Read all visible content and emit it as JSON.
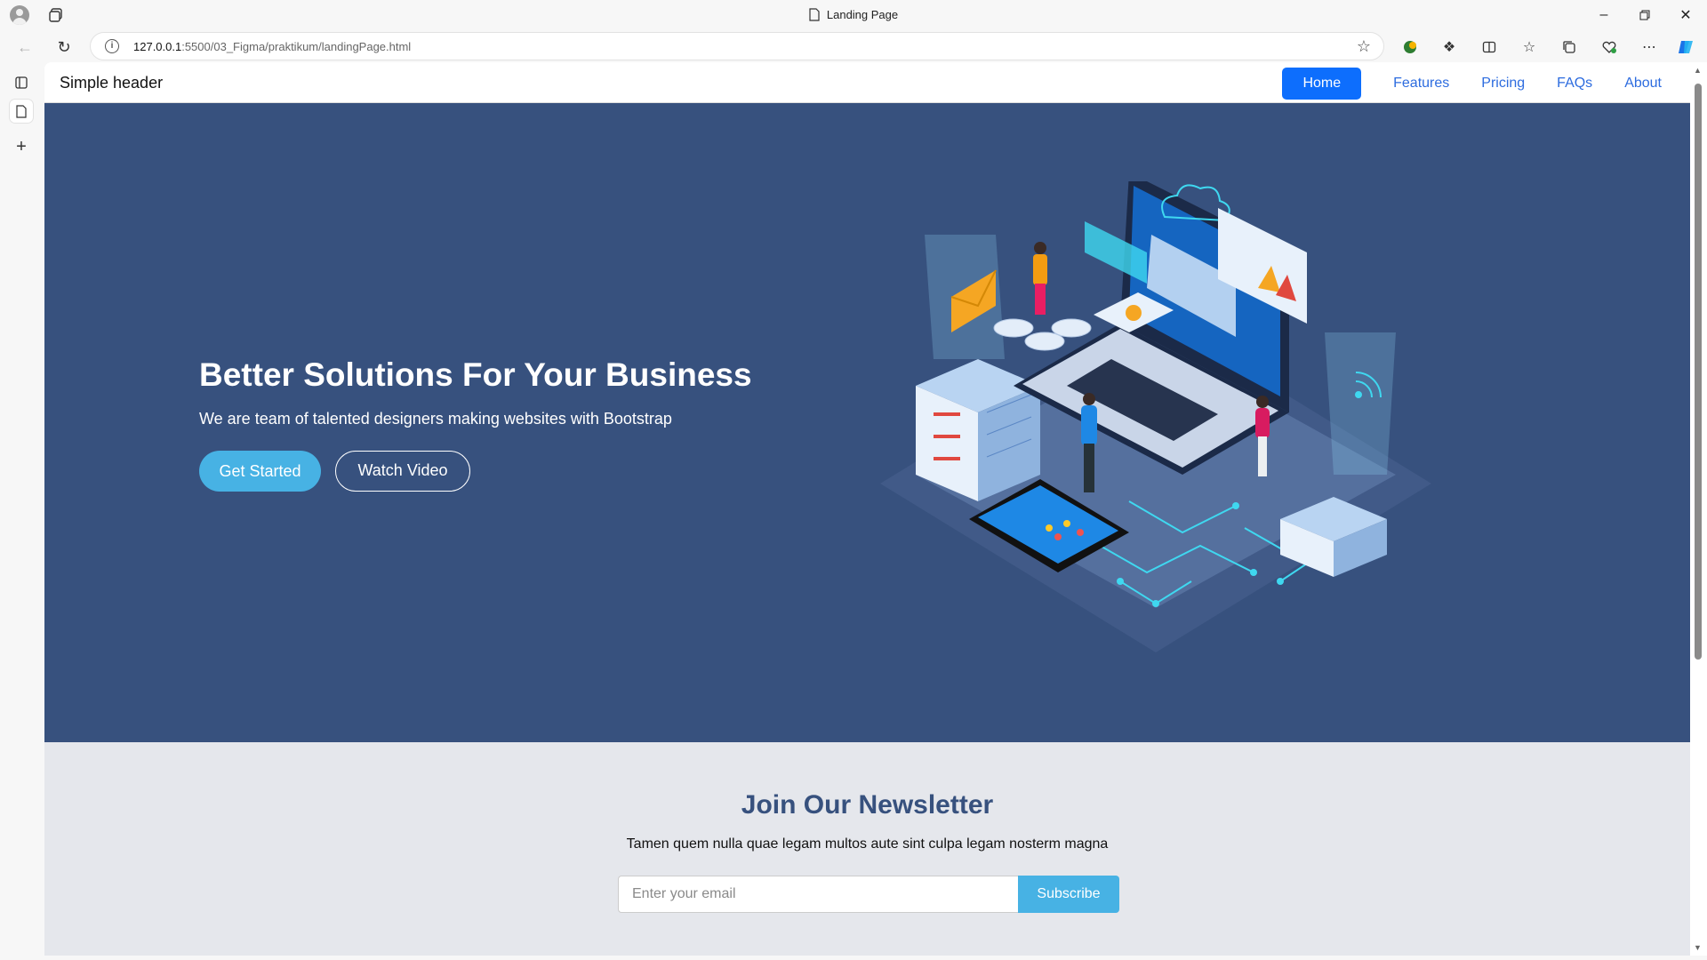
{
  "browser": {
    "tab_title": "Landing Page",
    "url_host": "127.0.0.1",
    "url_rest": ":5500/03_Figma/praktikum/landingPage.html"
  },
  "header": {
    "brand": "Simple header",
    "nav": [
      {
        "label": "Home",
        "active": true
      },
      {
        "label": "Features"
      },
      {
        "label": "Pricing"
      },
      {
        "label": "FAQs"
      },
      {
        "label": "About"
      }
    ]
  },
  "hero": {
    "title": "Better Solutions For Your Business",
    "subtitle": "We are team of talented designers making websites with Bootstrap",
    "primary_button": "Get Started",
    "secondary_button": "Watch Video"
  },
  "newsletter": {
    "title": "Join Our Newsletter",
    "description": "Tamen quem nulla quae legam multos aute sint culpa legam nosterm magna",
    "email_placeholder": "Enter your email",
    "subscribe_button": "Subscribe"
  },
  "colors": {
    "hero_bg": "#37517e",
    "accent": "#47b2e4",
    "nav_active": "#0d6efd",
    "nav_link": "#2d6cdf",
    "newsletter_bg": "#e5e7ec"
  }
}
